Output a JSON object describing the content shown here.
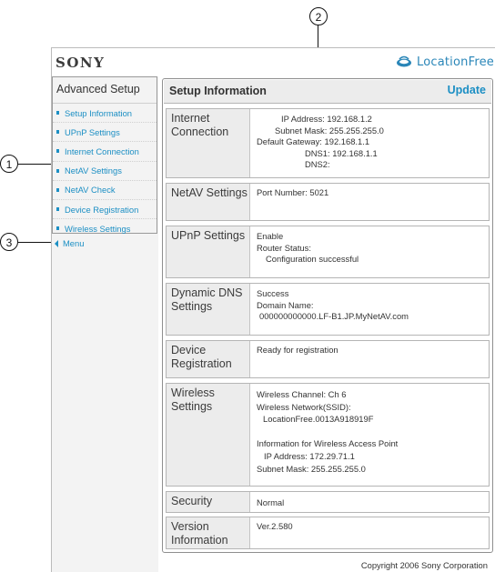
{
  "callouts": {
    "one": "1",
    "two": "2",
    "three": "3"
  },
  "header": {
    "brand": "SONY",
    "product_logo": "LocationFree",
    "logo_icon": "locationfree-logo-icon"
  },
  "sidebar": {
    "title": "Advanced Setup",
    "items": [
      {
        "label": "Setup Information"
      },
      {
        "label": "UPnP Settings"
      },
      {
        "label": "Internet Connection"
      },
      {
        "label": "NetAV Settings"
      },
      {
        "label": "NetAV Check"
      },
      {
        "label": "Device Registration"
      },
      {
        "label": "Wireless Settings"
      }
    ],
    "menu_label": "Menu"
  },
  "main": {
    "title": "Setup Information",
    "update_label": "Update",
    "sections": {
      "internet": {
        "label": "Internet Connection",
        "lines": [
          "IP Address: 192.168.1.2",
          "Subnet Mask: 255.255.255.0",
          "Default Gateway: 192.168.1.1",
          "DNS1: 192.168.1.1",
          "DNS2:"
        ]
      },
      "netav": {
        "label": "NetAV Settings",
        "lines": [
          "Port Number: 5021"
        ]
      },
      "upnp": {
        "label": "UPnP Settings",
        "lines": [
          "Enable",
          "Router Status:",
          "Configuration successful"
        ]
      },
      "ddns": {
        "label": "Dynamic DNS Settings",
        "lines": [
          "Success",
          "Domain Name:",
          "000000000000.LF-B1.JP.MyNetAV.com"
        ]
      },
      "device": {
        "label": "Device Registration",
        "lines": [
          "Ready for registration"
        ]
      },
      "wireless": {
        "label": "Wireless Settings",
        "lines": [
          "Wireless Channel: Ch 6",
          "Wireless Network(SSID):",
          "LocationFree.0013A918919F",
          "Information for Wireless Access Point",
          "IP Address: 172.29.71.1",
          "Subnet Mask: 255.255.255.0"
        ]
      },
      "security": {
        "label": "Security",
        "lines": [
          "Normal"
        ]
      },
      "version": {
        "label": "Version Information",
        "lines": [
          "Ver.2.580"
        ]
      }
    }
  },
  "footer": {
    "copyright": "Copyright 2006 Sony Corporation"
  },
  "colors": {
    "link": "#1c8fc4",
    "label_bg": "#ececec",
    "border": "#b5b5b5"
  }
}
